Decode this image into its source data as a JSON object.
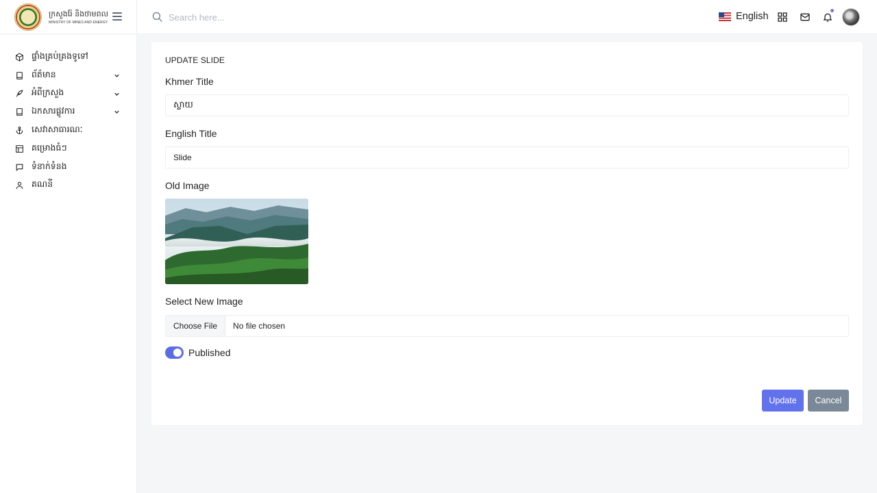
{
  "brand": {
    "khmer_name": "ក្រសួងរ៉ែ និងថាមពល",
    "english_name": "MINISTRY OF MINES AND ENERGY"
  },
  "sidebar": {
    "items": [
      {
        "label": "ផ្ទាំងគ្រប់គ្រងទូទៅ",
        "icon": "box-icon"
      },
      {
        "label": "ព័ត៌មាន",
        "icon": "book-icon"
      },
      {
        "label": "អំពីក្រសួង",
        "icon": "feather-icon"
      },
      {
        "label": "ឯកសារផ្លូវការ",
        "icon": "book-icon"
      },
      {
        "label": "សេវាសាធារណៈ",
        "icon": "anchor-icon"
      },
      {
        "label": "គម្រោងធំៗ",
        "icon": "layout-icon"
      },
      {
        "label": "ទំនាក់ទំនង",
        "icon": "message-icon"
      },
      {
        "label": "គណនី",
        "icon": "user-icon"
      }
    ]
  },
  "topbar": {
    "search_placeholder": "Search here...",
    "language": "English"
  },
  "form": {
    "title": "UPDATE SLIDE",
    "khmer_title_label": "Khmer Title",
    "khmer_title_value": "ស្លាយ",
    "english_title_label": "English Title",
    "english_title_value": "Slide",
    "old_image_label": "Old Image",
    "new_image_label": "Select New Image",
    "choose_file_label": "Choose File",
    "file_status": "No file chosen",
    "published_label": "Published",
    "published": true,
    "update_label": "Update",
    "cancel_label": "Cancel"
  },
  "colors": {
    "primary": "#6272ec",
    "secondary": "#7b8898",
    "background": "#f5f6f8"
  }
}
